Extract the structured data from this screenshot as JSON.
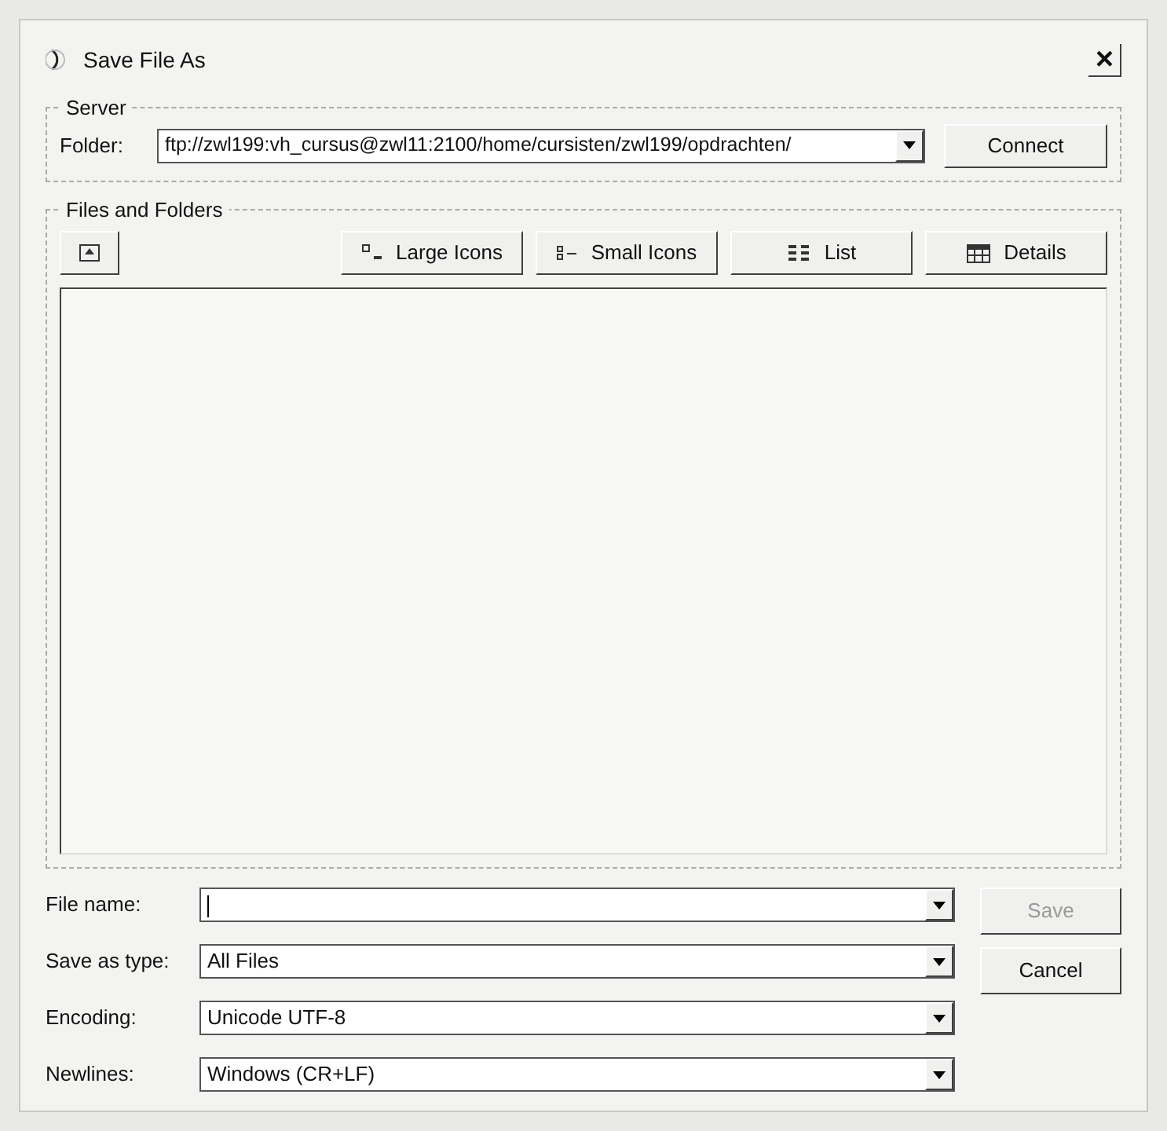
{
  "window": {
    "title": "Save File As",
    "close": "×"
  },
  "server": {
    "legend": "Server",
    "folder_label": "Folder:",
    "folder_value": "ftp://zwl199:vh_cursus@zwl11:2100/home/cursisten/zwl199/opdrachten/",
    "connect": "Connect"
  },
  "files": {
    "legend": "Files and Folders",
    "views": [
      {
        "label": "Large Icons",
        "kind": "large"
      },
      {
        "label": "Small Icons",
        "kind": "small"
      },
      {
        "label": "List",
        "kind": "list"
      },
      {
        "label": "Details",
        "kind": "details"
      }
    ]
  },
  "fields": [
    {
      "label": "File name:"
    },
    {
      "label": "Save as type:",
      "value": "All Files"
    },
    {
      "label": "Encoding:",
      "value": "Unicode UTF-8"
    },
    {
      "label": "Newlines:",
      "value": "Windows (CR+LF)"
    }
  ],
  "buttons": [
    {
      "label": "Save",
      "disabled": true
    },
    {
      "label": "Cancel",
      "disabled": false
    }
  ]
}
